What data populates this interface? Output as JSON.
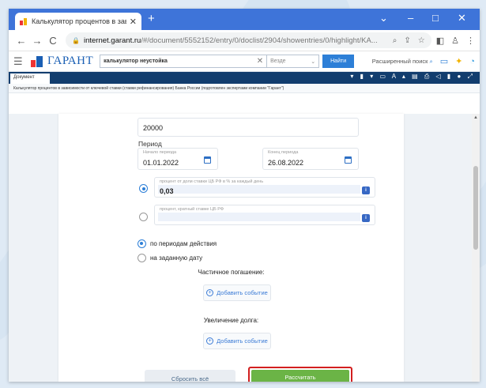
{
  "browser": {
    "tab_title": "Калькулятор процентов в зави:",
    "new_tab": "+",
    "window_controls": [
      "⌄",
      "–",
      "□",
      "✕"
    ],
    "nav": [
      "←",
      "→",
      "C"
    ],
    "url_host": "internet.garant.ru",
    "url_path": "/#/document/5552152/entry/0/doclist/2904/showentries/0/highlight/KA..."
  },
  "garant": {
    "logo_text": "ГАРАНТ",
    "search_query": "калькулятор неустойка",
    "search_where": "Везде",
    "find_button": "Найти",
    "advanced_search": "Расширенный поиск"
  },
  "doc": {
    "tab_label": "Документ",
    "breadcrumb": "Калькулятор процентов в зависимости от ключевой ставки (ставки рефинансирования) Банка России (подготовлен экспертами компании \"Гарант\")"
  },
  "form": {
    "amount": "20000",
    "period_title": "Период",
    "period_start_label": "Начало периода",
    "period_start": "01.01.2022",
    "period_end_label": "Конец периода",
    "period_end": "26.08.2022",
    "rate1_label": "процент от доли ставки ЦБ РФ в % за каждый день",
    "rate1_value": "0,03",
    "rate2_label": "процент, кратный ставке ЦБ РФ",
    "rate2_value": "",
    "option_periods": "по периодам действия",
    "option_date": "на заданную дату",
    "partial_title": "Частичное погашение:",
    "add_event": "Добавить событие",
    "increase_title": "Увеличение долга:",
    "reset_button": "Сбросить всё",
    "calc_button": "Рассчитать"
  }
}
